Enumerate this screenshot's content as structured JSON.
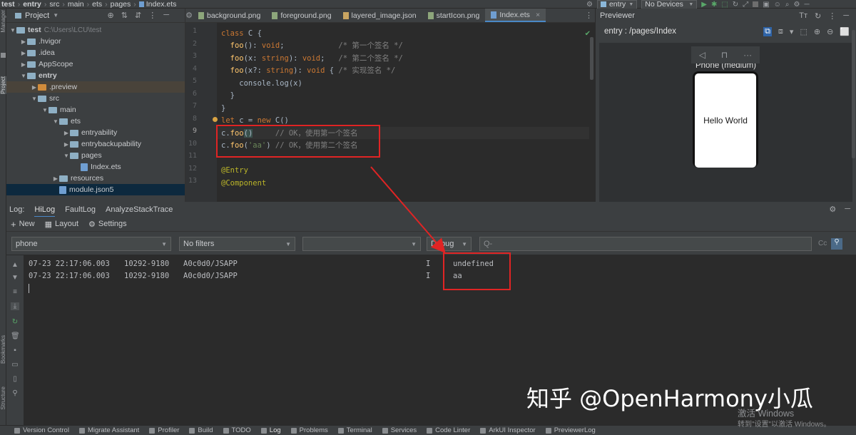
{
  "breadcrumb": [
    "test",
    "entry",
    "src",
    "main",
    "ets",
    "pages",
    "Index.ets"
  ],
  "toolbar": {
    "run_config": "entry",
    "device": "No Devices"
  },
  "left_strip": {
    "project_label": "Project",
    "bookmarks_label": "Bookmarks",
    "structure_label": "Structure"
  },
  "project_panel": {
    "title": "Project",
    "tree": [
      {
        "label": "test",
        "extra": "C:\\Users\\LCU\\test",
        "indent": 0,
        "arrow": "down",
        "icon": "folder"
      },
      {
        "label": ".hvigor",
        "indent": 1,
        "arrow": "right",
        "icon": "folder"
      },
      {
        "label": ".idea",
        "indent": 1,
        "arrow": "right",
        "icon": "folder"
      },
      {
        "label": "AppScope",
        "indent": 1,
        "arrow": "right",
        "icon": "folder"
      },
      {
        "label": "entry",
        "indent": 1,
        "arrow": "down",
        "icon": "folder",
        "bold": true
      },
      {
        "label": ".preview",
        "indent": 2,
        "arrow": "right",
        "icon": "folder-orange"
      },
      {
        "label": "src",
        "indent": 2,
        "arrow": "down",
        "icon": "folder"
      },
      {
        "label": "main",
        "indent": 3,
        "arrow": "down",
        "icon": "folder"
      },
      {
        "label": "ets",
        "indent": 4,
        "arrow": "down",
        "icon": "folder"
      },
      {
        "label": "entryability",
        "indent": 5,
        "arrow": "right",
        "icon": "folder"
      },
      {
        "label": "entrybackupability",
        "indent": 5,
        "arrow": "right",
        "icon": "folder"
      },
      {
        "label": "pages",
        "indent": 5,
        "arrow": "down",
        "icon": "folder"
      },
      {
        "label": "Index.ets",
        "indent": 6,
        "arrow": "",
        "icon": "file"
      },
      {
        "label": "resources",
        "indent": 4,
        "arrow": "right",
        "icon": "folder"
      },
      {
        "label": "module.json5",
        "indent": 4,
        "arrow": "",
        "icon": "file"
      }
    ]
  },
  "editor": {
    "tabs": [
      "background.png",
      "foreground.png",
      "layered_image.json",
      "startIcon.png",
      "Index.ets"
    ],
    "active_tab": "Index.ets",
    "line_numbers": [
      "1",
      "2",
      "3",
      "4",
      "5",
      "6",
      "7",
      "8",
      "9",
      "10",
      "11",
      "12",
      "13"
    ],
    "code": {
      "l1_kw": "class",
      "l1_rest": " C {",
      "l2_fn": "  foo",
      "l2_a": "(): ",
      "l2_kw": "void",
      "l2_b": ";            ",
      "l2_cm": "/* 第一个签名 */",
      "l3_fn": "  foo",
      "l3_a": "(x: ",
      "l3_kw1": "string",
      "l3_b": "): ",
      "l3_kw2": "void",
      "l3_c": ";   ",
      "l3_cm": "/* 第二个签名 */",
      "l4_fn": "  foo",
      "l4_a": "(x?: ",
      "l4_kw1": "string",
      "l4_b": "): ",
      "l4_kw2": "void",
      "l4_c": " { ",
      "l4_cm": "/* 实现签名 */",
      "l5": "    console.log(x)",
      "l6": "  }",
      "l7": "}",
      "l8_kw": "let",
      "l8_a": " c = ",
      "l8_kw2": "new",
      "l8_b": " C()",
      "l9_a": "c.",
      "l9_fn": "foo",
      "l9_b": "()",
      "l9_cm": "     // OK，使用第一个签名",
      "l10_a": "c.",
      "l10_fn": "foo",
      "l10_b": "(",
      "l10_str": "'aa'",
      "l10_c": ")",
      "l10_cm": " // OK，使用第二个签名",
      "l12": "@Entry",
      "l13": "@Component"
    }
  },
  "previewer": {
    "title": "Previewer",
    "route": "entry : /pages/Index",
    "device_label": "Phone (medium)",
    "screen_text": "Hello World"
  },
  "log": {
    "label": "Log:",
    "tabs": [
      "HiLog",
      "FaultLog",
      "AnalyzeStackTrace"
    ],
    "tools": [
      "New",
      "Layout",
      "Settings"
    ],
    "device_filter": "phone",
    "filter": "No filters",
    "process_filter": "",
    "level": "Debug",
    "search_placeholder": "Q-",
    "cc": "Cc",
    "rows": [
      {
        "time": "07-23 22:17:06.003",
        "pid": "10292-9180",
        "tag": "A0c0d0/JSAPP",
        "level": "I",
        "msg": "undefined"
      },
      {
        "time": "07-23 22:17:06.003",
        "pid": "10292-9180",
        "tag": "A0c0d0/JSAPP",
        "level": "I",
        "msg": "aa"
      }
    ]
  },
  "statusbar": [
    "Version Control",
    "Migrate Assistant",
    "Profiler",
    "Build",
    "TODO",
    "Log",
    "Problems",
    "Terminal",
    "Services",
    "Code Linter",
    "ArkUI Inspector",
    "PreviewerLog"
  ],
  "watermark": "知乎 @OpenHarmony小瓜",
  "activation": {
    "line1": "激活 Windows",
    "line2": "转到\"设置\"以激活 Windows。"
  },
  "colors": {
    "highlight_box": "#e02424",
    "accent": "#4a88c7"
  }
}
